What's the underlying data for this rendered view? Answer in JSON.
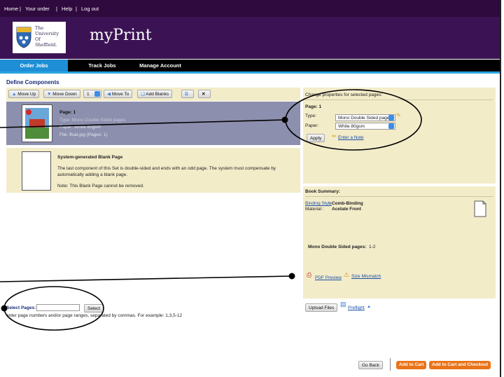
{
  "top_links": [
    "Home",
    "Your order",
    "Help",
    "Log out"
  ],
  "top_sep": "|",
  "logo": {
    "lines": [
      "The",
      "University",
      "Of",
      "Sheffield."
    ]
  },
  "app_title": "myPrint",
  "nav": {
    "order_jobs": "Order Jobs",
    "track_jobs": "Track Jobs",
    "manage_account": "Manage Account"
  },
  "section_title": "Define Components",
  "toolbar": {
    "move_up": "Move Up",
    "move_down": "Move Down",
    "position_value": "1",
    "move_to": "Move To",
    "add_blanks": "Add Blanks"
  },
  "page_item": {
    "index": "1",
    "title": "Page: 1",
    "type": "Type: Mono Double Sided pages",
    "paper": "Paper: White 80gsm",
    "file": "File: float.jpg (Pages: 1)"
  },
  "blank_item": {
    "title": "System-generated Blank Page",
    "desc": "The last component of this Set is double-sided and ends with an odd page. The system must compensate by automatically adding a blank page.",
    "note": "Note: This Blank Page cannot be removed."
  },
  "props": {
    "header": "Change properties for selected pages:",
    "page": "Page: 1",
    "type_label": "Type:",
    "type_value": "Mono Double Sided page",
    "paper_label": "Paper:",
    "paper_value": "White 80gsm",
    "apply": "Apply",
    "enter_note": "Enter a Note"
  },
  "summary": {
    "title": "Book Summary:",
    "binding_link": "Binding Style",
    "binding_value": ": Comb-Binding",
    "material_label": "Material :",
    "material_value": "Acetate Front",
    "mono_label": "Mono Double Sided pages:",
    "mono_value": "1-2",
    "pdf_preview": "PDF Preview",
    "size_mismatch": "Size Mismatch"
  },
  "upload": {
    "upload_files": "Upload Files",
    "preflight": "Preflight"
  },
  "select_pages": {
    "label": "Select Pages:",
    "button": "Select",
    "hint": "enter page numbers and/or page ranges, separated by commas. For example: 1,3,5-12"
  },
  "footer": {
    "go_back": "Go Back",
    "add_to_cart": "Add to Cart",
    "add_checkout": "Add to Cart and Checkout"
  },
  "colors": {
    "banner": "#3b1354",
    "nav_active": "#1e8fd6",
    "panel": "#f3ecc9",
    "selected": "#8c8fad",
    "orange": "#e97419"
  }
}
